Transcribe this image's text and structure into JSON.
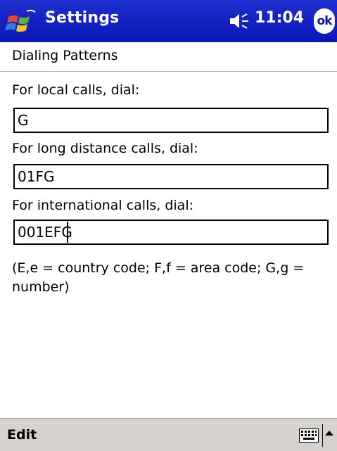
{
  "titlebar": {
    "app_title": "Settings",
    "time": "11:04",
    "ok_label": "ok",
    "start_icon": "windows-flag-icon",
    "speaker_icon": "speaker-icon",
    "background": "#0a17b6"
  },
  "page": {
    "title": "Dialing Patterns"
  },
  "fields": [
    {
      "label": "For local calls, dial:",
      "value": "G"
    },
    {
      "label": "For long distance calls, dial:",
      "value": "01FG"
    },
    {
      "label": "For international calls, dial:",
      "value": "001EFG"
    }
  ],
  "help": {
    "text": "(E,e = country code; F,f = area code; G,g = number)"
  },
  "menubar": {
    "edit_label": "Edit",
    "keyboard_icon": "keyboard-icon",
    "sip_arrow_icon": "chevron-up-icon"
  }
}
